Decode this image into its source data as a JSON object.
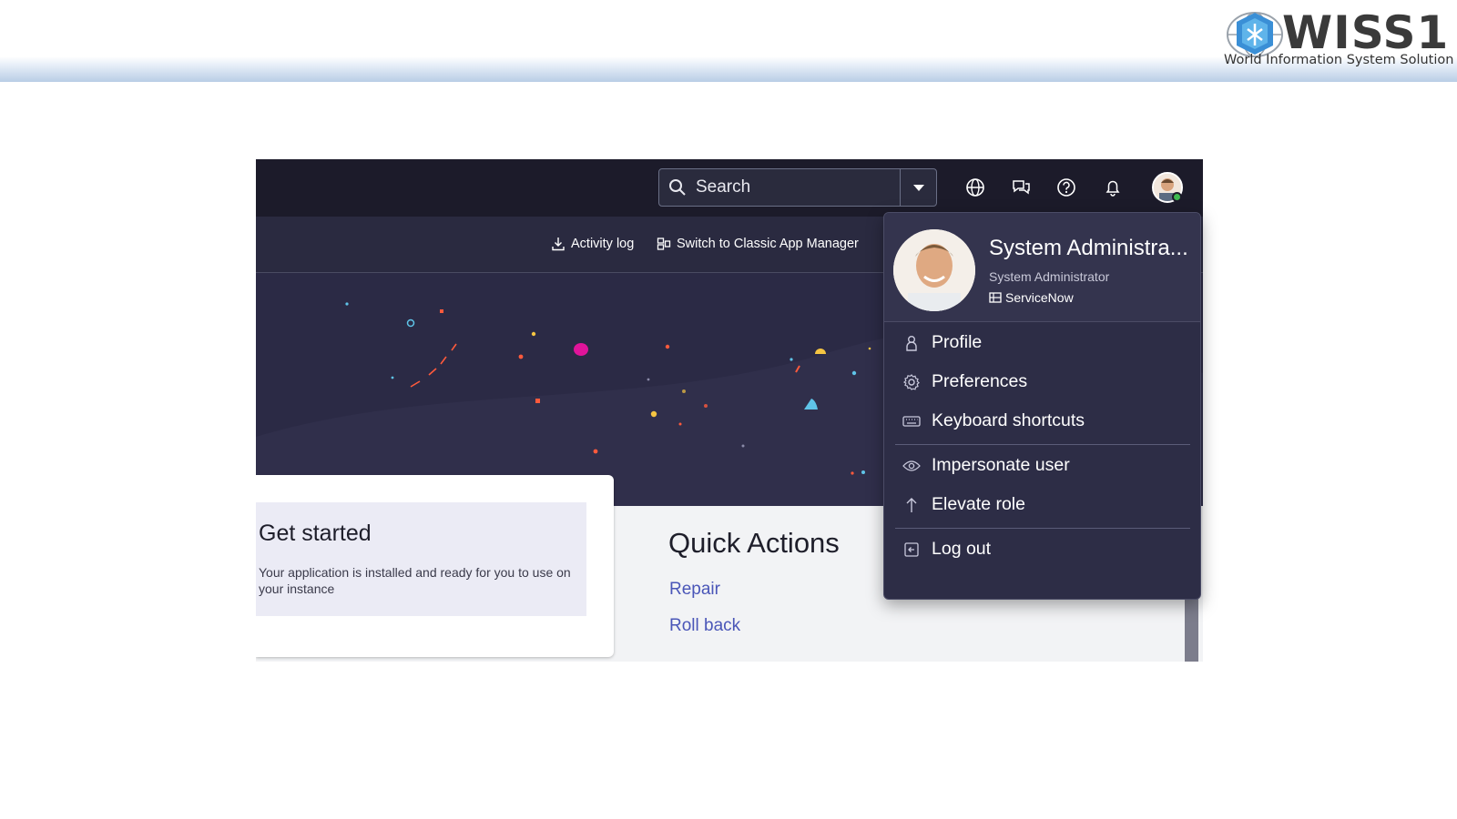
{
  "logo": {
    "brand": "WISS1",
    "tagline": "World Information System Solution"
  },
  "topbar": {
    "search_label": "Search",
    "icons": [
      "search-icon",
      "chevron-down-icon",
      "globe-icon",
      "chat-icon",
      "help-icon",
      "bell-icon",
      "avatar"
    ]
  },
  "subbar": {
    "activity_log": "Activity log",
    "switch_classic": "Switch to Classic App Manager"
  },
  "card": {
    "title": "Get started",
    "description": "Your application is installed and ready for you to use on your instance"
  },
  "quick_actions": {
    "title": "Quick Actions",
    "repair": "Repair",
    "roll_back": "Roll back"
  },
  "user_menu": {
    "name": "System Administra...",
    "role": "System Administrator",
    "company": "ServiceNow",
    "items": [
      {
        "label": "Profile",
        "icon": "user-icon"
      },
      {
        "label": "Preferences",
        "icon": "gear-icon"
      },
      {
        "label": "Keyboard shortcuts",
        "icon": "keyboard-icon"
      },
      {
        "label": "Impersonate user",
        "icon": "eye-icon"
      },
      {
        "label": "Elevate role",
        "icon": "arrow-up-icon"
      },
      {
        "label": "Log out",
        "icon": "logout-icon"
      }
    ]
  },
  "colors": {
    "topbar": "#1c1b2a",
    "hero": "#2b2a45",
    "menu": "#2d2d46",
    "link": "#4a56b8",
    "status_online": "#3fb950"
  }
}
